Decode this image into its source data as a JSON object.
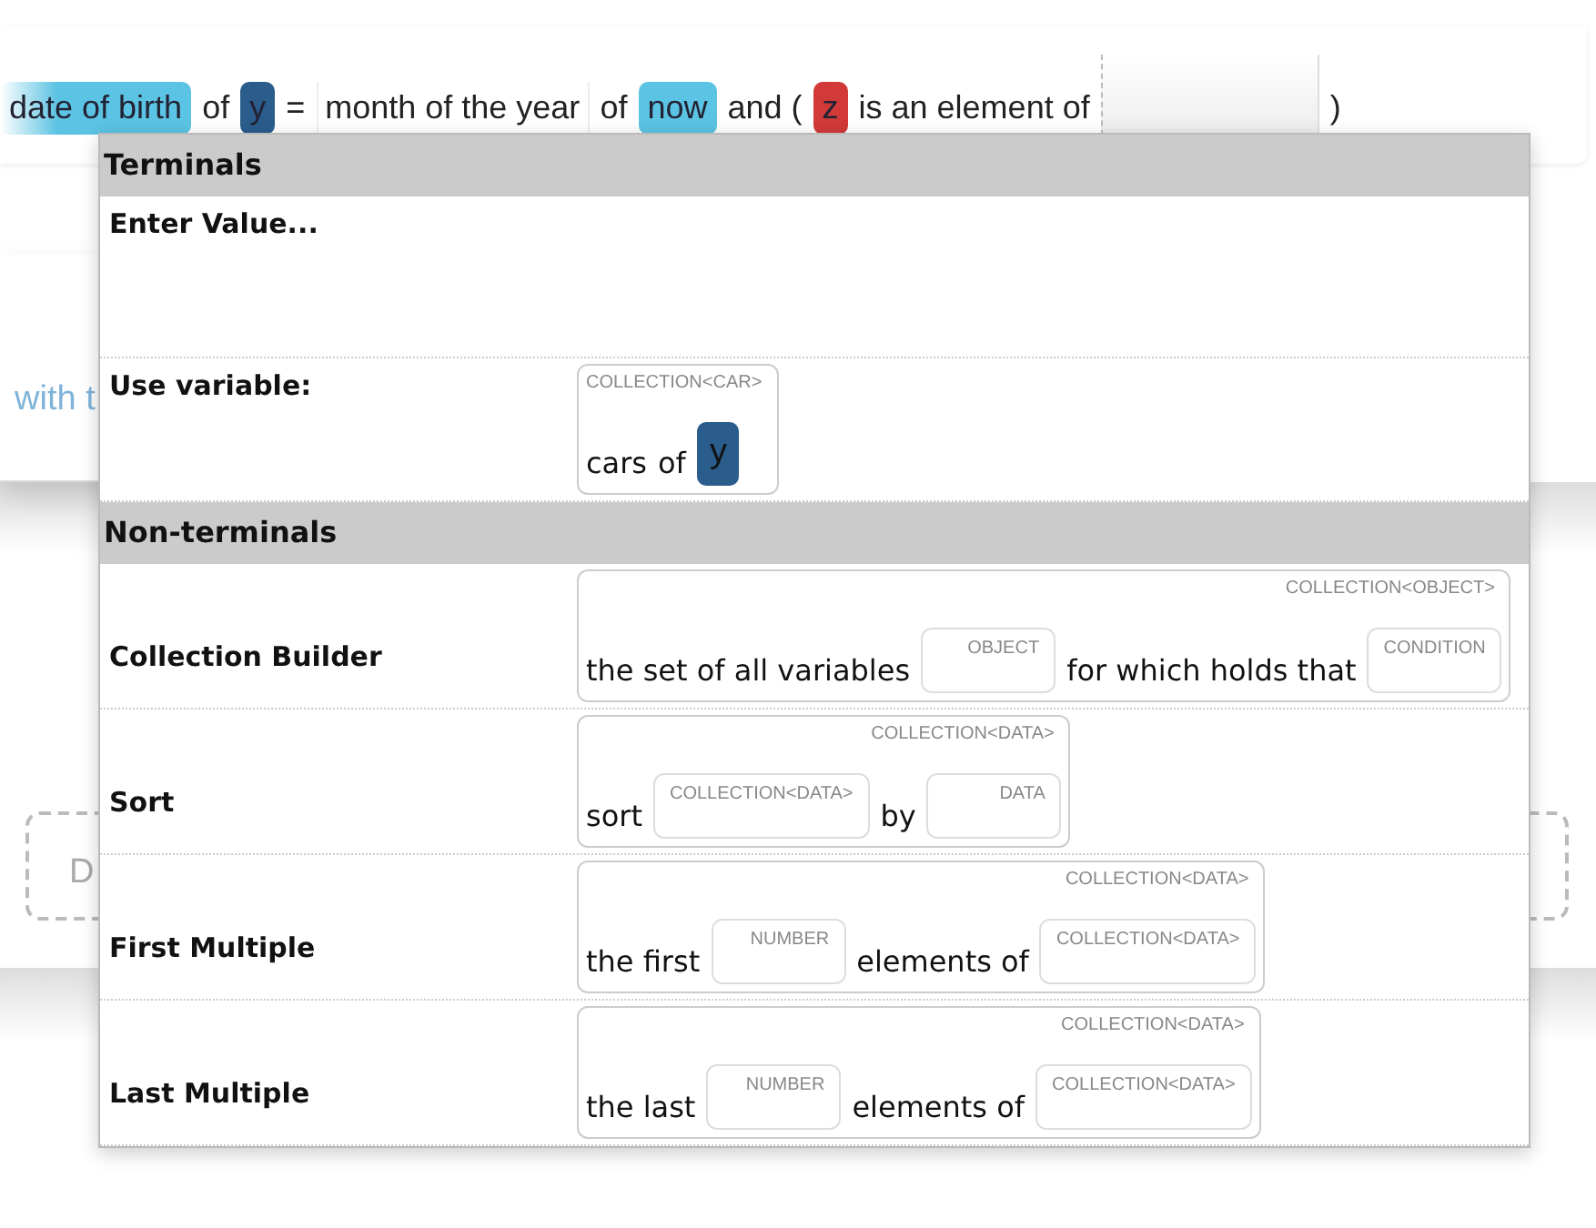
{
  "expression": [
    {
      "kind": "chip",
      "text": "date of birth",
      "color": "#5bc3e3"
    },
    {
      "kind": "word",
      "text": "of"
    },
    {
      "kind": "chip",
      "text": "y",
      "color": "#2a5d8c"
    },
    {
      "kind": "word",
      "text": "="
    },
    {
      "kind": "box",
      "text": "month of the year"
    },
    {
      "kind": "word",
      "text": "of"
    },
    {
      "kind": "chip",
      "text": "now",
      "color": "#5bc3e3"
    },
    {
      "kind": "word",
      "text": "and ("
    },
    {
      "kind": "chip",
      "text": "z",
      "color": "#d13a38"
    },
    {
      "kind": "word",
      "text": "is an element of"
    },
    {
      "kind": "empty"
    },
    {
      "kind": "word",
      "text": ")"
    }
  ],
  "background": {
    "link_text": "with t",
    "dashed_field_text": "D"
  },
  "popup": [
    {
      "title": "Terminals",
      "rows": [
        {
          "kind": "input",
          "label": "Enter Value..."
        },
        {
          "kind": "template",
          "label": "Use variable:",
          "type": "COLLECTION<CAR>",
          "parts": [
            {
              "kind": "word",
              "text": "cars"
            },
            {
              "kind": "word",
              "text": "of"
            },
            {
              "kind": "var",
              "text": "y"
            }
          ]
        }
      ]
    },
    {
      "title": "Non-terminals",
      "rows": [
        {
          "kind": "template",
          "label": "Collection Builder",
          "type": "COLLECTION<OBJECT>",
          "parts": [
            {
              "kind": "word",
              "text": "the set of all variables"
            },
            {
              "kind": "slot",
              "text": "OBJECT"
            },
            {
              "kind": "word",
              "text": "for which holds that"
            },
            {
              "kind": "slot",
              "text": "CONDITION"
            }
          ]
        },
        {
          "kind": "template",
          "label": "Sort",
          "type": "COLLECTION<DATA>",
          "parts": [
            {
              "kind": "word",
              "text": "sort"
            },
            {
              "kind": "slot",
              "text": "COLLECTION<DATA>"
            },
            {
              "kind": "word",
              "text": "by"
            },
            {
              "kind": "slot",
              "text": "DATA"
            }
          ]
        },
        {
          "kind": "template",
          "label": "First Multiple",
          "type": "COLLECTION<DATA>",
          "parts": [
            {
              "kind": "word",
              "text": "the first"
            },
            {
              "kind": "slot",
              "text": "NUMBER"
            },
            {
              "kind": "word",
              "text": "elements of"
            },
            {
              "kind": "slot",
              "text": "COLLECTION<DATA>"
            }
          ]
        },
        {
          "kind": "template",
          "label": "Last Multiple",
          "type": "COLLECTION<DATA>",
          "parts": [
            {
              "kind": "word",
              "text": "the last"
            },
            {
              "kind": "slot",
              "text": "NUMBER"
            },
            {
              "kind": "word",
              "text": "elements of"
            },
            {
              "kind": "slot",
              "text": "COLLECTION<DATA>"
            }
          ]
        }
      ]
    }
  ]
}
